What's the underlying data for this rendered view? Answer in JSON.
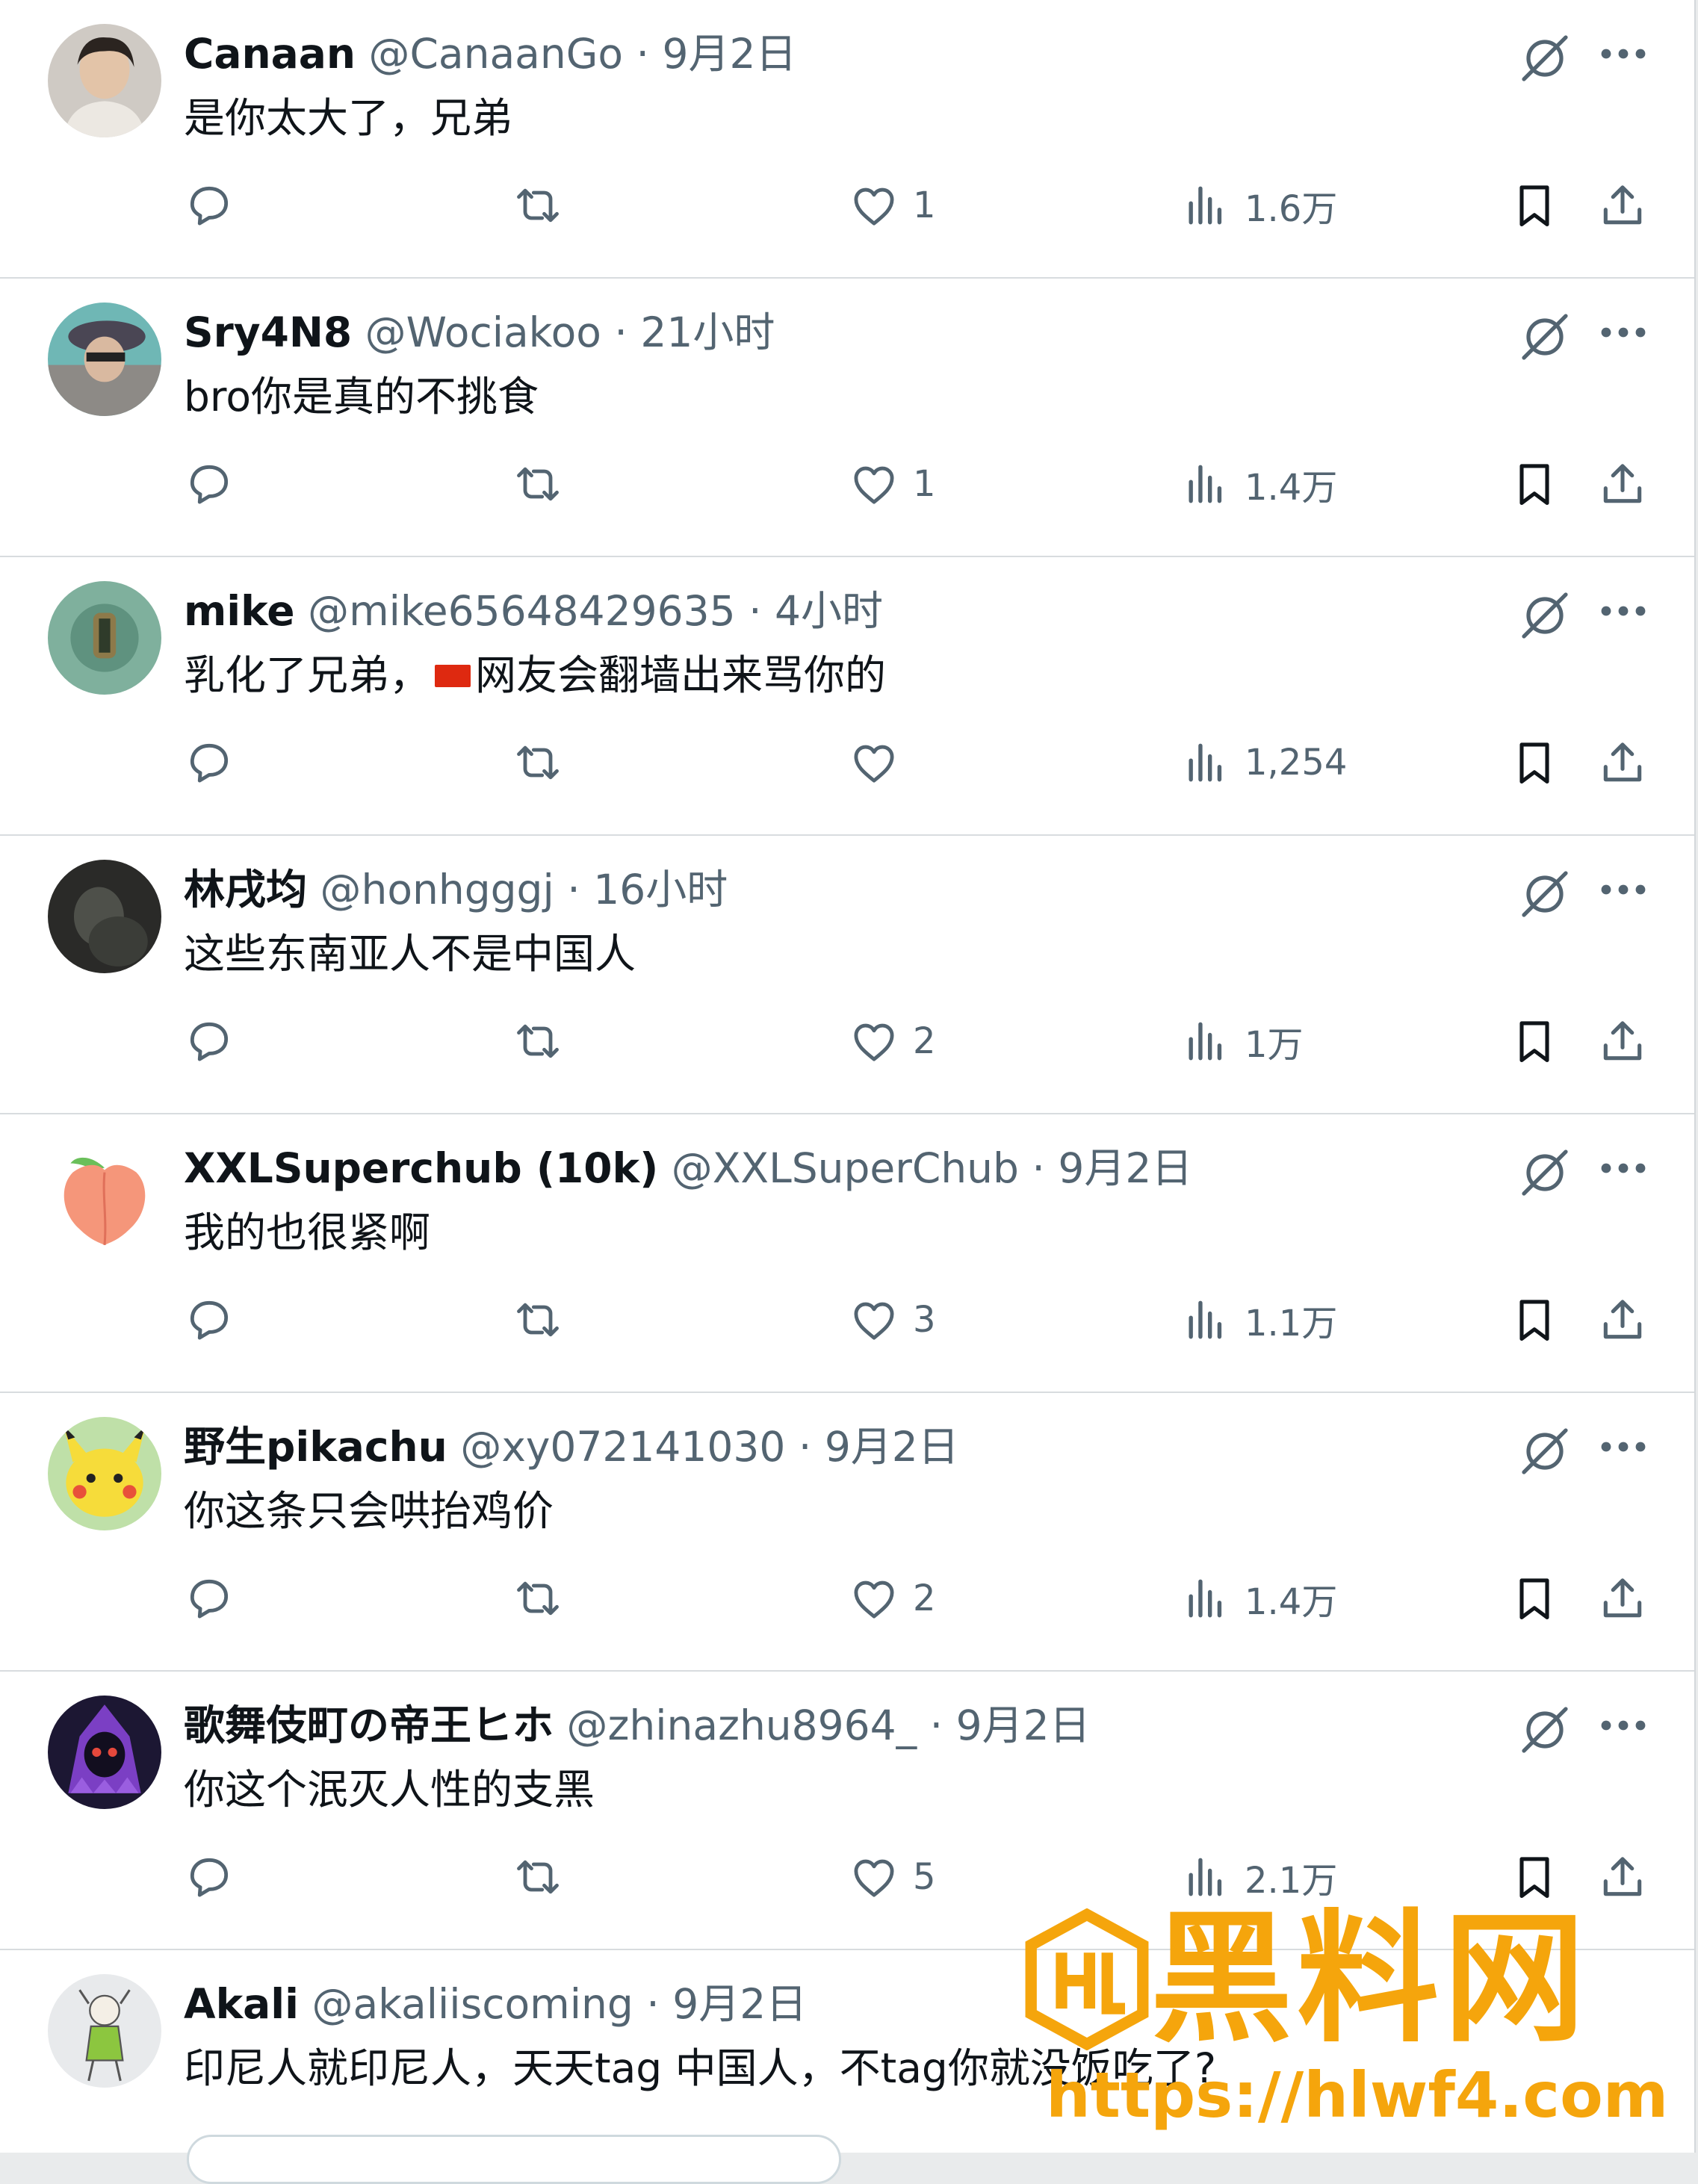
{
  "replies": [
    {
      "name": "Canaan",
      "handle": "@CanaanGo",
      "sep": "·",
      "time": "9月2日",
      "text": "是你太大了，兄弟",
      "likes": "1",
      "views": "1.6万"
    },
    {
      "name": "Sry4N8",
      "handle": "@Wociakoo",
      "sep": "·",
      "time": "21小时",
      "text": "bro你是真的不挑食",
      "likes": "1",
      "views": "1.4万"
    },
    {
      "name": "mike",
      "handle": "@mike65648429635",
      "sep": "·",
      "time": "4小时",
      "text_before": "乳化了兄弟，",
      "text_after": "网友会翻墙出来骂你的",
      "likes": "",
      "views": "1,254"
    },
    {
      "name": "林戌均",
      "handle": "@honhgggj",
      "sep": "·",
      "time": "16小时",
      "text": "这些东南亚人不是中国人",
      "likes": "2",
      "views": "1万"
    },
    {
      "name": "XXLSuperchub (10k)",
      "handle": "@XXLSuperChub",
      "sep": "·",
      "time": "9月2日",
      "text": "我的也很紧啊",
      "likes": "3",
      "views": "1.1万"
    },
    {
      "name": "野生pikachu",
      "handle": "@xy072141030",
      "sep": "·",
      "time": "9月2日",
      "text": "你这条只会哄抬鸡价",
      "likes": "2",
      "views": "1.4万"
    },
    {
      "name": "歌舞伎町の帝王ヒホ",
      "handle": "@zhinazhu8964_",
      "sep": "·",
      "time": "9月2日",
      "text": "你这个泯灭人性的支黑",
      "likes": "5",
      "views": "2.1万"
    },
    {
      "name": "Akali",
      "handle": "@akaliiscoming",
      "sep": "·",
      "time": "9月2日",
      "text": "印尼人就印尼人，天天tag 中国人，不tag你就没饭吃了?"
    }
  ],
  "watermark": {
    "brand": "黑料网",
    "url": "https://hlwf4.com"
  },
  "icons": [
    "reply-icon",
    "retweet-icon",
    "like-icon",
    "views-icon",
    "bookmark-icon",
    "share-icon",
    "grok-icon",
    "more-icon"
  ],
  "colors": {
    "muted": "#536471",
    "text": "#0f1419",
    "divider": "#d8dcdf",
    "watermark": "#f5a50c"
  }
}
